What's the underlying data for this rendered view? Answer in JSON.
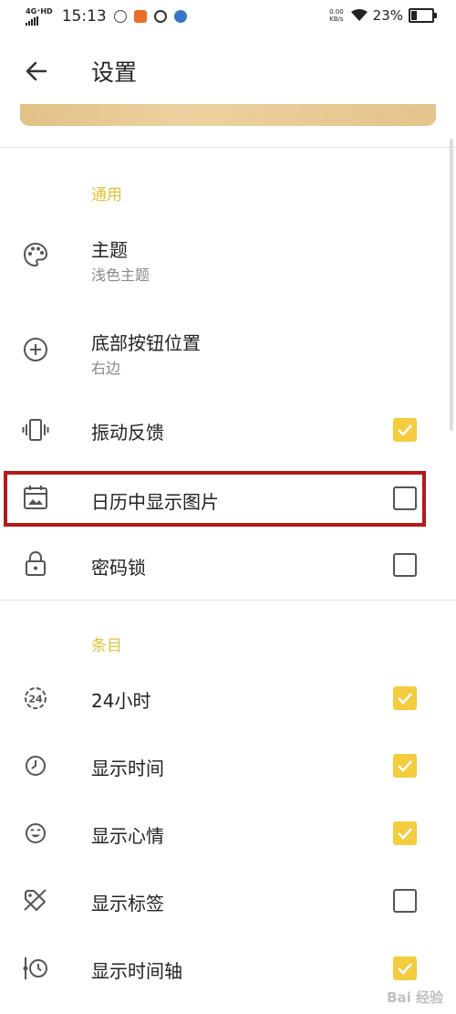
{
  "status_bar": {
    "network": "4G⁺HD",
    "time": "15:13",
    "speed_top": "0.00",
    "speed_bottom": "KB/s",
    "battery": "23%"
  },
  "header": {
    "title": "设置"
  },
  "sections": {
    "general": "通用",
    "entries": "条目"
  },
  "general_items": {
    "theme": {
      "label": "主题",
      "value": "浅色主题"
    },
    "bottom_button": {
      "label": "底部按钮位置",
      "value": "右边"
    },
    "vibration": {
      "label": "振动反馈",
      "checked": true
    },
    "calendar_images": {
      "label": "日历中显示图片",
      "checked": false
    },
    "password_lock": {
      "label": "密码锁",
      "checked": false
    }
  },
  "entry_items": {
    "hours24": {
      "label": "24小时",
      "checked": true,
      "icon_text": "24"
    },
    "show_time": {
      "label": "显示时间",
      "checked": true
    },
    "show_mood": {
      "label": "显示心情",
      "checked": true
    },
    "show_tags": {
      "label": "显示标签",
      "checked": false
    },
    "show_timeline": {
      "label": "显示时间轴",
      "checked": true
    }
  },
  "watermark": "Bai 经验",
  "colors": {
    "accent": "#f4cc3e",
    "section": "#e6c13a",
    "highlight": "#b5191c"
  }
}
